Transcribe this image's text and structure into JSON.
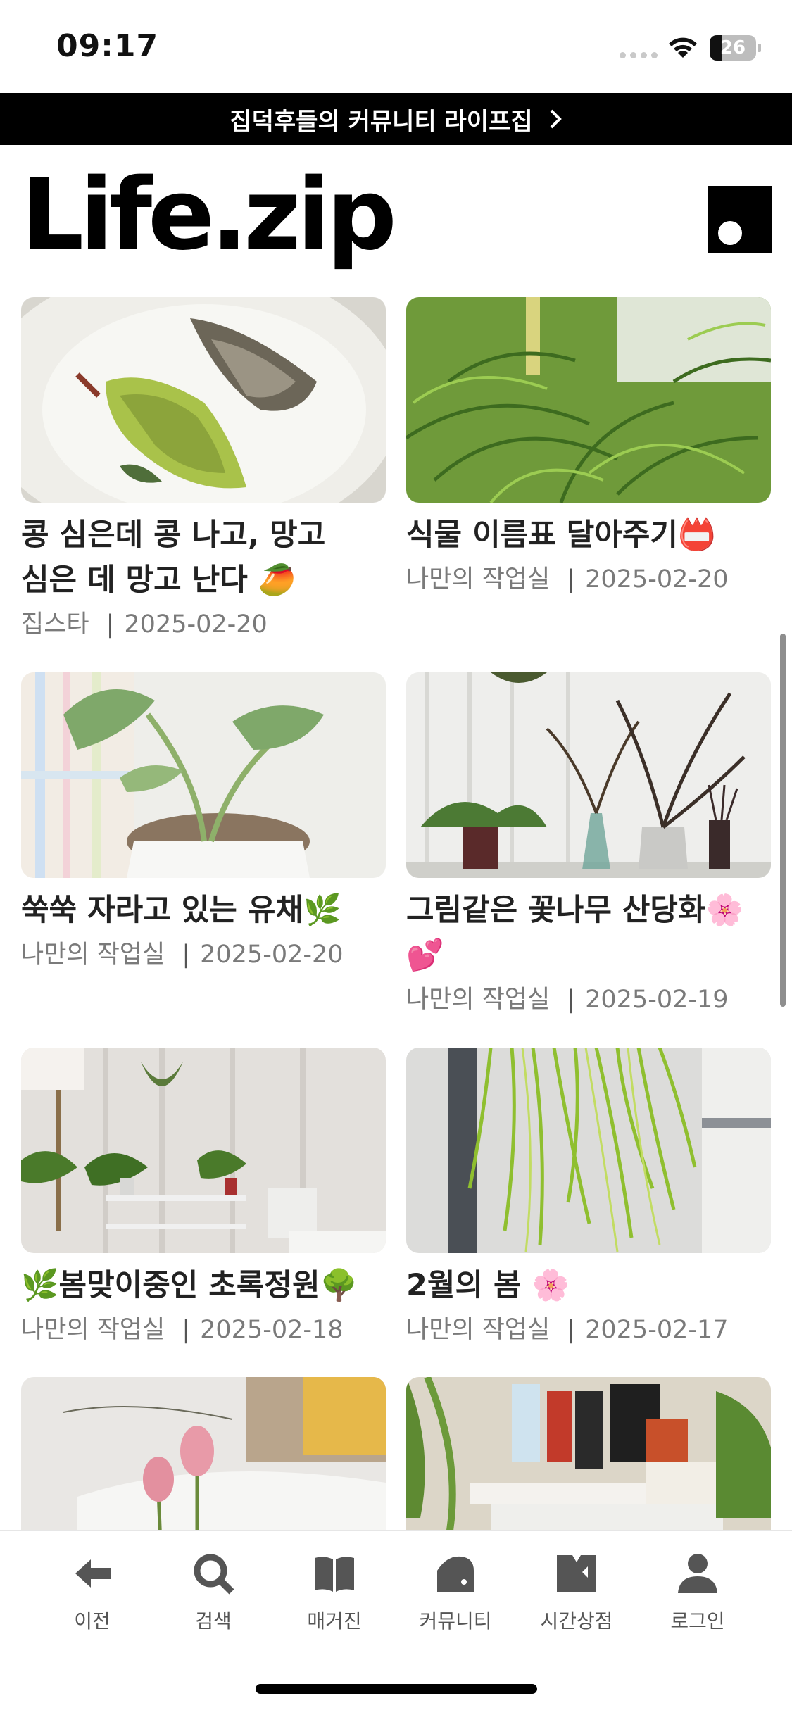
{
  "status_bar": {
    "time": "09:17",
    "battery": "26",
    "battery_level": 0.26
  },
  "banner": {
    "text": "집덕후들의 커뮤니티 라이프집"
  },
  "header": {
    "logo": "Life.zip"
  },
  "posts": [
    {
      "title": "콩 심은데 콩 나고, 망고 심은 데 망고 난다 🥭",
      "author": "집스타",
      "date": "2025-02-20",
      "image": "plate-avocado-photo"
    },
    {
      "title": "식물 이름표 달아주기📛",
      "author": "나만의 작업실",
      "date": "2025-02-20",
      "image": "asparagus-fern-photo"
    },
    {
      "title": "쑥쑥 자라고 있는 유채🌿",
      "author": "나만의 작업실",
      "date": "2025-02-20",
      "image": "potted-rapeseed-photo"
    },
    {
      "title": "그림같은 꽃나무 산당화🌸💕",
      "author": "나만의 작업실",
      "date": "2025-02-19",
      "image": "flowering-branch-vase-photo"
    },
    {
      "title": "🌿봄맞이중인 초록정원🌳",
      "author": "나만의 작업실",
      "date": "2025-02-18",
      "image": "indoor-garden-photo"
    },
    {
      "title": "2월의 봄 🌸",
      "author": "나만의 작업실",
      "date": "2025-02-17",
      "image": "hanging-plant-photo"
    },
    {
      "title": "",
      "author": "",
      "date": "",
      "image": "tulips-sofa-photo"
    },
    {
      "title": "",
      "author": "",
      "date": "",
      "image": "desk-products-photo"
    }
  ],
  "nav": {
    "items": [
      {
        "label": "이전",
        "icon": "arrow-left-icon"
      },
      {
        "label": "검색",
        "icon": "search-icon"
      },
      {
        "label": "매거진",
        "icon": "book-icon"
      },
      {
        "label": "커뮤니티",
        "icon": "house-icon"
      },
      {
        "label": "시간상점",
        "icon": "shop-icon"
      },
      {
        "label": "로그인",
        "icon": "user-icon"
      }
    ]
  },
  "colors": {
    "banner_bg": "#000000",
    "meta_text": "#7a7a7a",
    "nav_icon": "#555555"
  }
}
